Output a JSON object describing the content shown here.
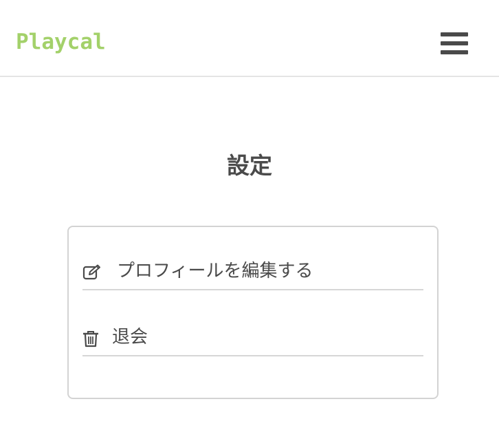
{
  "header": {
    "brand": "Playcal",
    "brand_color": "#a3d16a",
    "menu_icon": "hamburger-menu-icon"
  },
  "main": {
    "title": "設定",
    "menu": [
      {
        "icon": "edit-icon",
        "label": "プロフィールを編集する"
      },
      {
        "icon": "trash-icon",
        "label": "退会"
      }
    ]
  }
}
